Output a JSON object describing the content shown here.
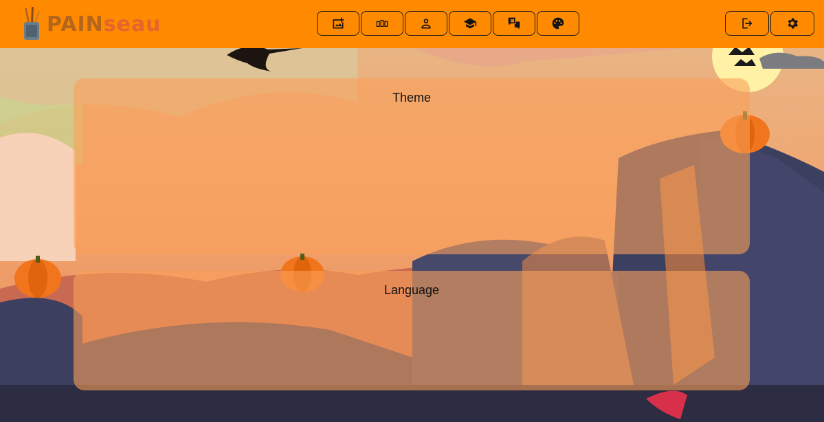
{
  "app": {
    "logo_text_part1": "PAIN",
    "logo_text_part2": "seau"
  },
  "nav": [
    {
      "name": "add-image-button",
      "icon": "add-photo-icon"
    },
    {
      "name": "gallery-button",
      "icon": "gallery-icon"
    },
    {
      "name": "profile-button",
      "icon": "person-icon"
    },
    {
      "name": "learn-button",
      "icon": "school-icon"
    },
    {
      "name": "translate-button",
      "icon": "translate-icon"
    },
    {
      "name": "theme-button",
      "icon": "palette-icon"
    }
  ],
  "right_nav": [
    {
      "name": "logout-button",
      "icon": "logout-icon"
    },
    {
      "name": "settings-button",
      "icon": "gear-icon"
    }
  ],
  "panels": {
    "theme_title": "Theme",
    "language_title": "Language"
  },
  "colors": {
    "topbar": "#ff8a00",
    "panel": "rgba(250,160,90,0.6)"
  }
}
